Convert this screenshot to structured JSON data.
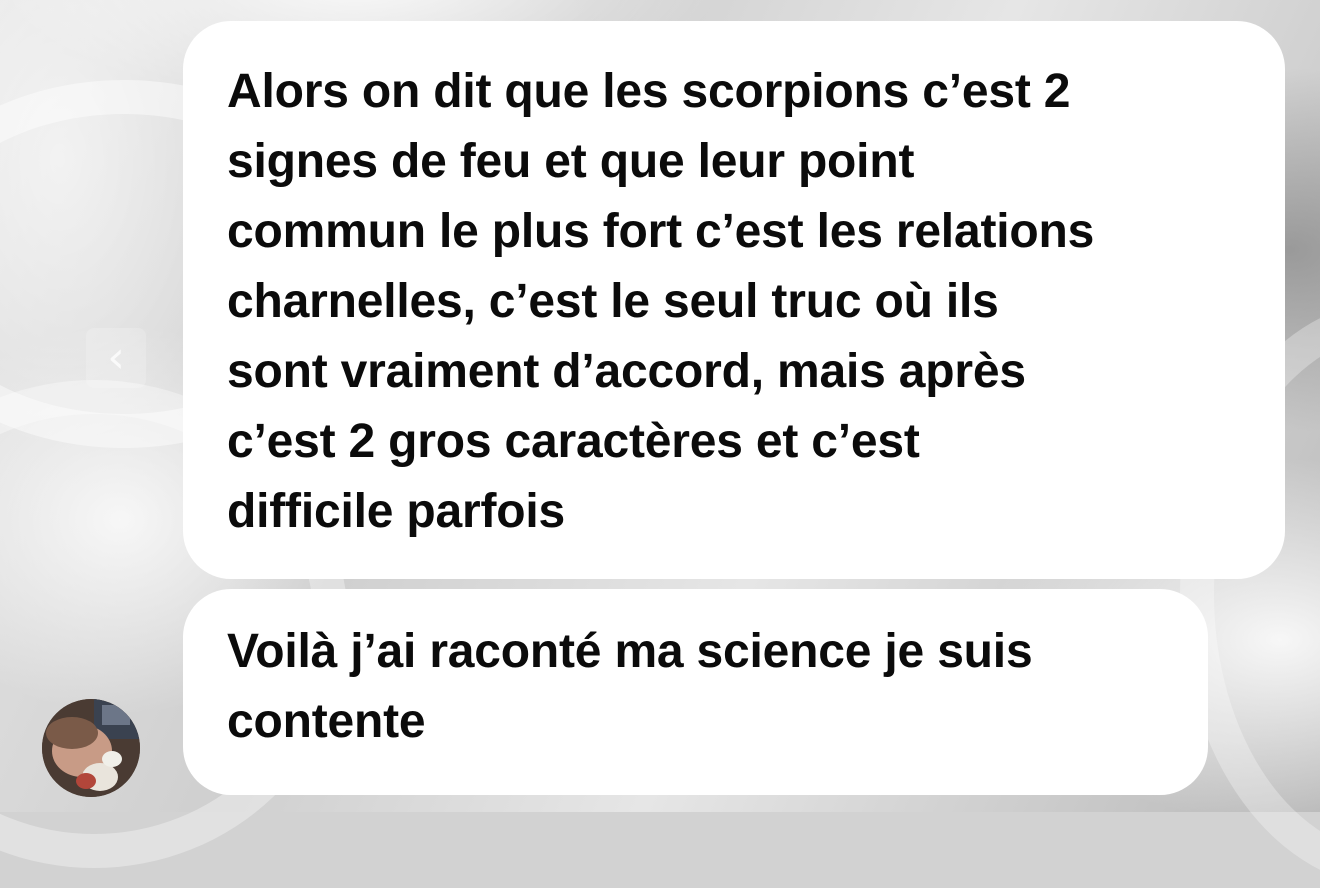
{
  "messages": [
    {
      "text": "Alors on dit que les scorpions c’est 2 signes de feu et que leur point commun le plus fort c’est les relations charnelles, c’est le seul truc où ils sont vraiment d’accord, mais après c’est 2 gros caractères et c’est difficile parfois",
      "lines": [
        "Alors on dit que les scorpions c’est 2",
        "signes de feu et que leur point",
        "commun le plus fort c’est les relations",
        "charnelles, c’est le seul truc où ils",
        "sont vraiment d’accord, mais après",
        "c’est 2 gros caractères et c’est",
        "difficile parfois"
      ]
    },
    {
      "text": "Voilà j’ai raconté ma science je suis contente",
      "lines": [
        "Voilà j’ai raconté ma science je suis",
        "contente"
      ]
    }
  ],
  "icons": {
    "back": "chevron-left-icon",
    "avatar": "sender-avatar"
  },
  "colors": {
    "bubble": "#ffffff",
    "text": "#0b0b0b"
  }
}
